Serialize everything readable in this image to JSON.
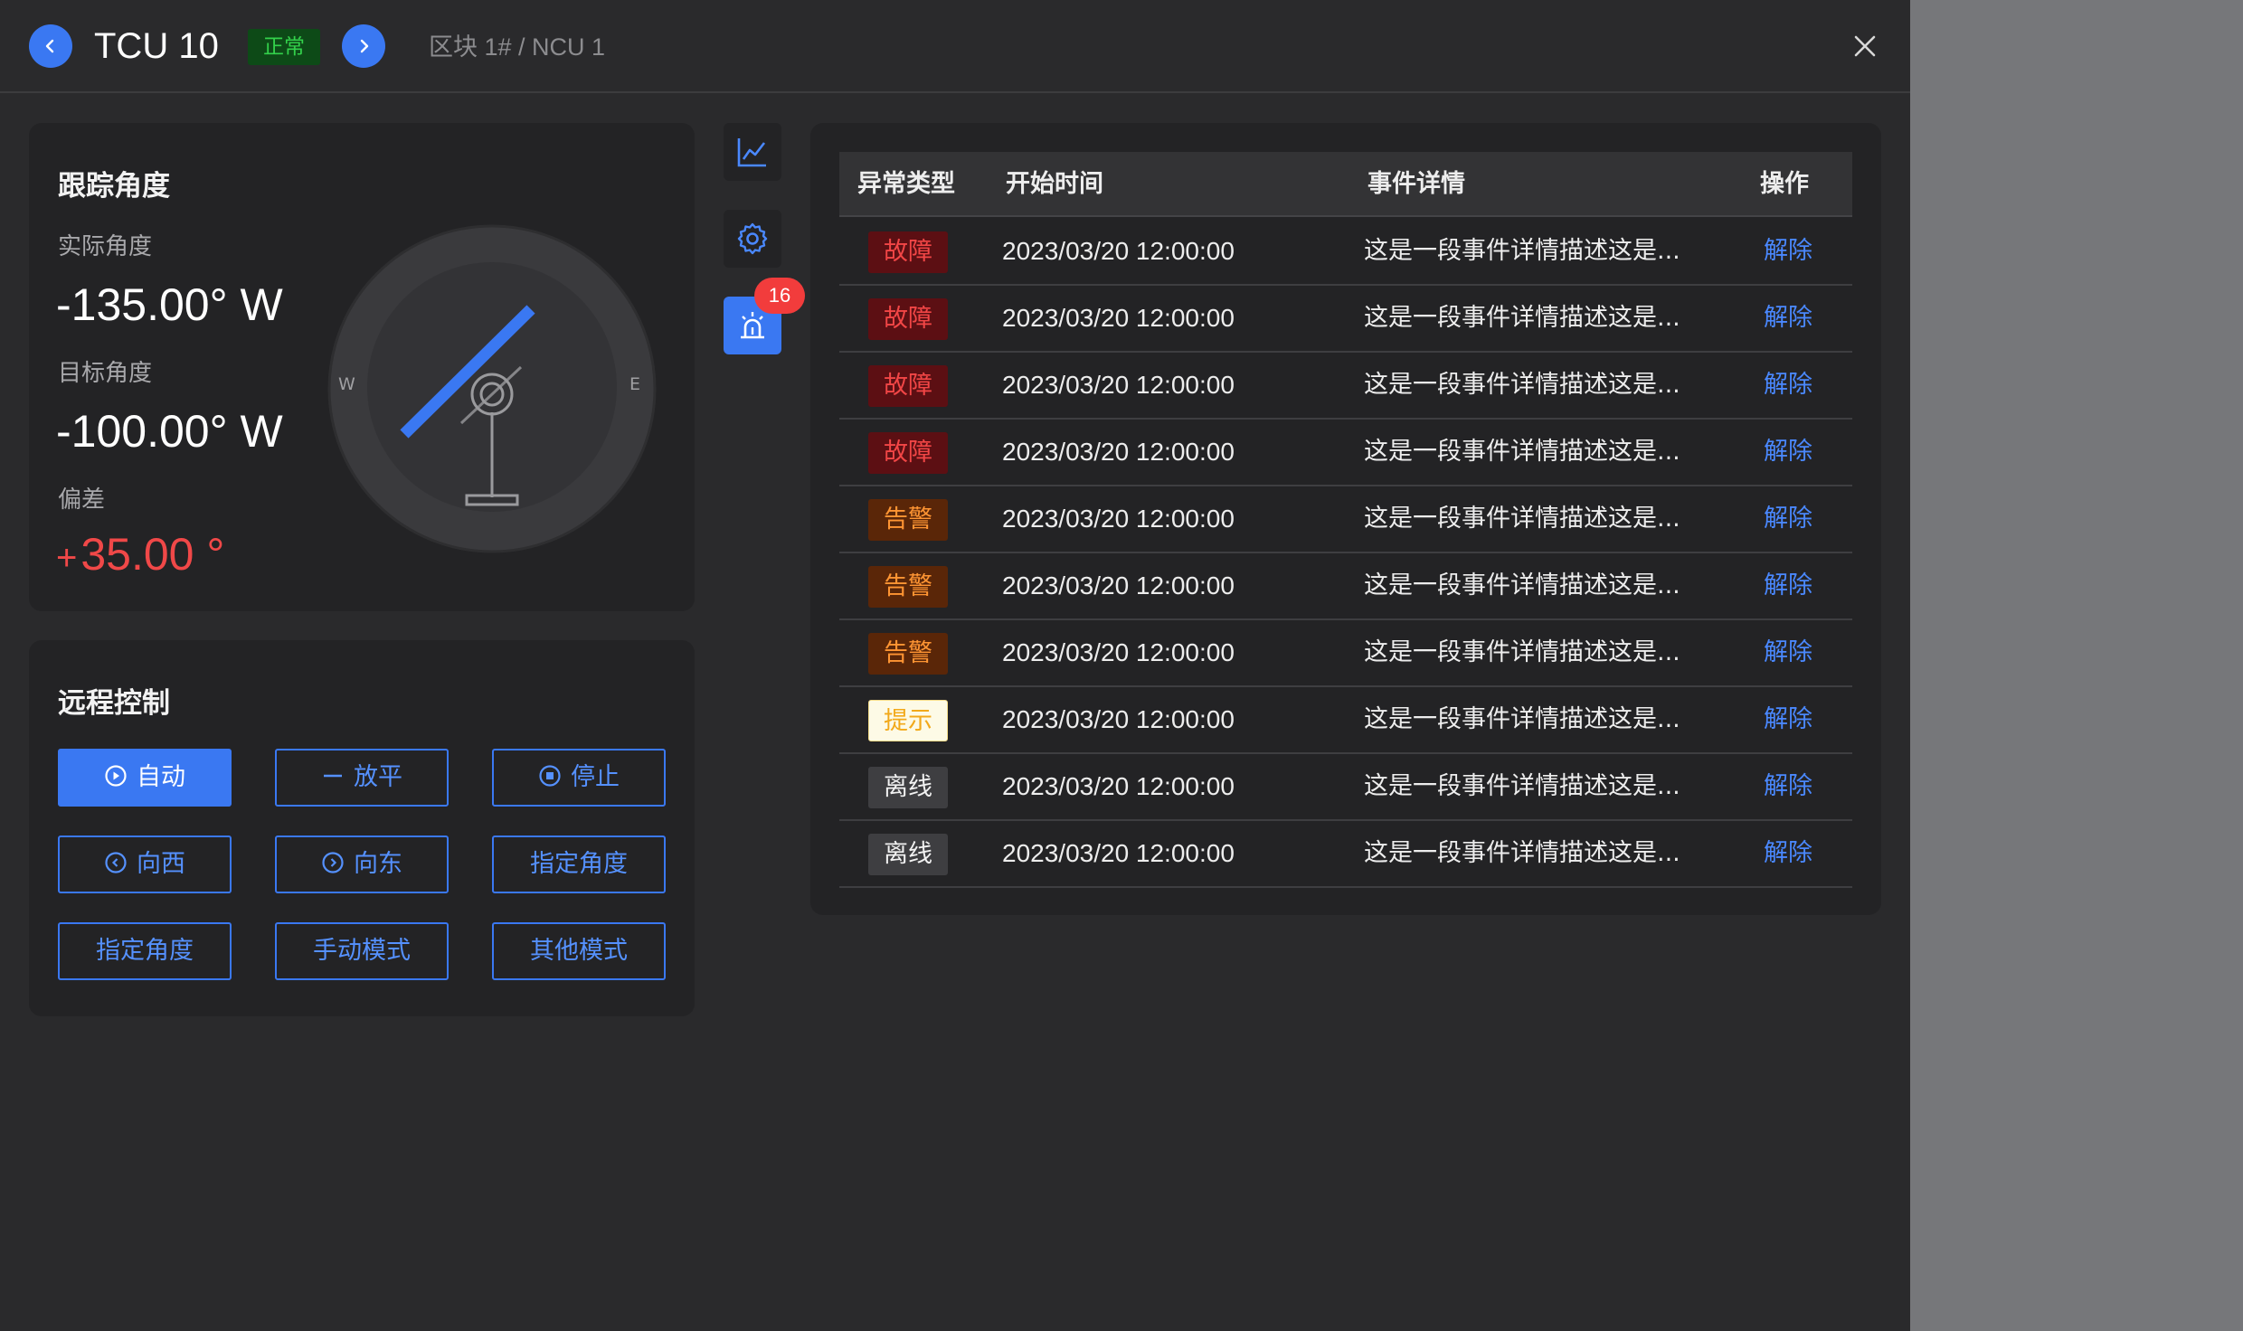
{
  "header": {
    "title": "TCU 10",
    "status": "正常",
    "breadcrumb": "区块 1# / NCU 1"
  },
  "tracking": {
    "title": "跟踪角度",
    "actual_label": "实际角度",
    "actual_value": "-135.00° W",
    "target_label": "目标角度",
    "target_value": "-100.00° W",
    "deviation_label": "偏差",
    "deviation_sign": "+",
    "deviation_value": "35.00 °",
    "compass_w": "W",
    "compass_e": "E"
  },
  "remote": {
    "title": "远程控制",
    "buttons": [
      "自动",
      "放平",
      "停止",
      "向西",
      "向东",
      "指定角度",
      "指定角度",
      "手动模式",
      "其他模式"
    ]
  },
  "side_tabs": {
    "alarm_badge": "16"
  },
  "events": {
    "columns": [
      "异常类型",
      "开始时间",
      "事件详情",
      "操作"
    ],
    "rows": [
      {
        "type": "故障",
        "time": "2023/03/20 12:00:00",
        "detail": "这是一段事件详情描述这是...",
        "action": "解除"
      },
      {
        "type": "故障",
        "time": "2023/03/20 12:00:00",
        "detail": "这是一段事件详情描述这是...",
        "action": "解除"
      },
      {
        "type": "故障",
        "time": "2023/03/20 12:00:00",
        "detail": "这是一段事件详情描述这是...",
        "action": "解除"
      },
      {
        "type": "故障",
        "time": "2023/03/20 12:00:00",
        "detail": "这是一段事件详情描述这是...",
        "action": "解除"
      },
      {
        "type": "告警",
        "time": "2023/03/20 12:00:00",
        "detail": "这是一段事件详情描述这是...",
        "action": "解除"
      },
      {
        "type": "告警",
        "time": "2023/03/20 12:00:00",
        "detail": "这是一段事件详情描述这是...",
        "action": "解除"
      },
      {
        "type": "告警",
        "time": "2023/03/20 12:00:00",
        "detail": "这是一段事件详情描述这是...",
        "action": "解除"
      },
      {
        "type": "提示",
        "time": "2023/03/20 12:00:00",
        "detail": "这是一段事件详情描述这是...",
        "action": "解除"
      },
      {
        "type": "离线",
        "time": "2023/03/20 12:00:00",
        "detail": "这是一段事件详情描述这是...",
        "action": "解除"
      },
      {
        "type": "离线",
        "time": "2023/03/20 12:00:00",
        "detail": "这是一段事件详情描述这是...",
        "action": "解除"
      }
    ]
  },
  "colors": {
    "accent": "#3a78f2",
    "fault": "#f24646",
    "alarm": "#ff9533",
    "hint": "#f2a91a",
    "normal": "#33d14b"
  }
}
